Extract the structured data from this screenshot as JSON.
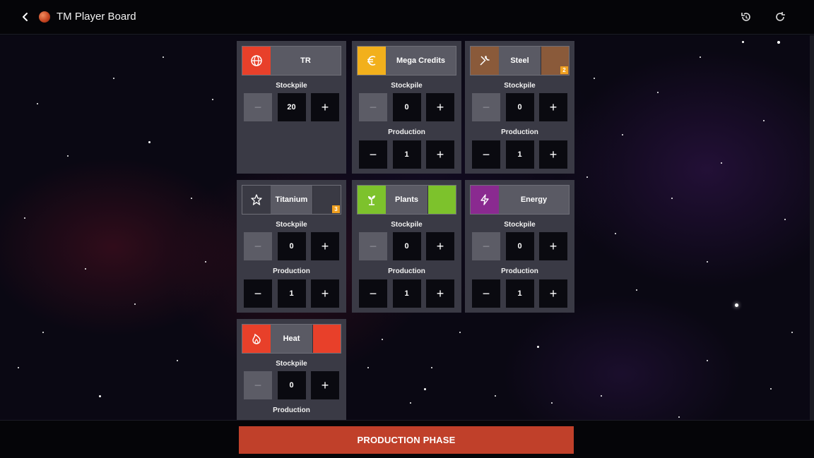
{
  "header": {
    "title": "TM Player Board",
    "back_icon": "chevron-left-icon",
    "logo_icon": "mars-planet-icon",
    "undo_icon": "undo-icon",
    "refresh_icon": "refresh-icon"
  },
  "labels": {
    "stockpile": "Stockpile",
    "production": "Production",
    "minus": "−",
    "plus": "+"
  },
  "resources": [
    {
      "id": "tr",
      "name": "TR",
      "icon": "globe-icon",
      "color": "#e8402a",
      "stockpile": 20,
      "stockpile_minus_disabled": true
    },
    {
      "id": "megacredits",
      "name": "Mega Credits",
      "icon": "euro-icon",
      "color": "#f2b01c",
      "stockpile": 0,
      "production": 1,
      "stockpile_minus_disabled": true
    },
    {
      "id": "steel",
      "name": "Steel",
      "icon": "wrench-icon",
      "color": "#8a5a3a",
      "stockpile": 0,
      "production": 1,
      "badge": "2",
      "stockpile_minus_disabled": true
    },
    {
      "id": "titanium",
      "name": "Titanium",
      "icon": "star-icon",
      "color": "#3a3a44",
      "stockpile": 0,
      "production": 1,
      "badge": "3",
      "stockpile_minus_disabled": true
    },
    {
      "id": "plants",
      "name": "Plants",
      "icon": "sprout-icon",
      "color": "#7dc22c",
      "stockpile": 0,
      "production": 1,
      "stockpile_minus_disabled": true
    },
    {
      "id": "energy",
      "name": "Energy",
      "icon": "lightning-icon",
      "color": "#8a2a90",
      "stockpile": 0,
      "production": 1,
      "stockpile_minus_disabled": true
    },
    {
      "id": "heat",
      "name": "Heat",
      "icon": "flame-icon",
      "color": "#e8402a",
      "stockpile": 0,
      "stockpile_minus_disabled": true
    }
  ],
  "footer": {
    "production_phase_label": "PRODUCTION PHASE"
  }
}
